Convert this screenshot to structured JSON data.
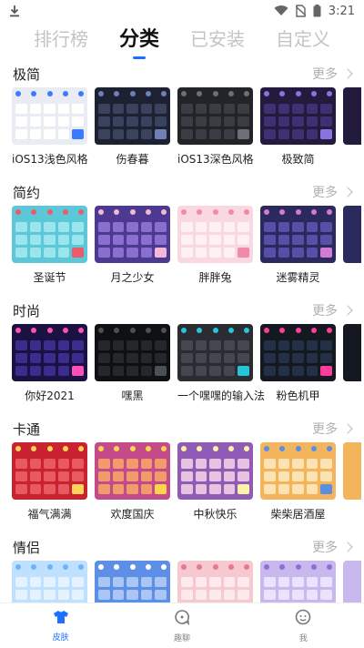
{
  "status_bar": {
    "time": "3:21"
  },
  "top_tabs": [
    {
      "label": "排行榜",
      "active": false
    },
    {
      "label": "分类",
      "active": true
    },
    {
      "label": "已安装",
      "active": false
    },
    {
      "label": "自定义",
      "active": false
    }
  ],
  "more_label": "更多",
  "sections": [
    {
      "title": "极简",
      "items": [
        {
          "name": "iOS13浅色风格",
          "theme": "light"
        },
        {
          "name": "伤春暮",
          "theme": "navy"
        },
        {
          "name": "iOS13深色风格",
          "theme": "dark"
        },
        {
          "name": "极致简",
          "theme": "purple"
        }
      ]
    },
    {
      "title": "简约",
      "items": [
        {
          "name": "圣诞节",
          "theme": "teal"
        },
        {
          "name": "月之少女",
          "theme": "violet"
        },
        {
          "name": "胖胖兔",
          "theme": "pink"
        },
        {
          "name": "迷雾精灵",
          "theme": "mist"
        }
      ]
    },
    {
      "title": "时尚",
      "items": [
        {
          "name": "你好2021",
          "theme": "neon"
        },
        {
          "name": "嘿黑",
          "theme": "black"
        },
        {
          "name": "一个嘿嘿的输入法",
          "theme": "charcoal"
        },
        {
          "name": "粉色机甲",
          "theme": "mecha"
        }
      ]
    },
    {
      "title": "卡通",
      "items": [
        {
          "name": "福气满满",
          "theme": "red"
        },
        {
          "name": "欢度国庆",
          "theme": "orange"
        },
        {
          "name": "中秋快乐",
          "theme": "autumn"
        },
        {
          "name": "柴柴居酒屋",
          "theme": "shiba"
        }
      ]
    },
    {
      "title": "情侣",
      "items": [
        {
          "name": "",
          "theme": "sky"
        },
        {
          "name": "",
          "theme": "blue"
        },
        {
          "name": "",
          "theme": "rose"
        },
        {
          "name": "",
          "theme": "lilac"
        }
      ]
    }
  ],
  "bottom_nav": [
    {
      "label": "皮肤",
      "icon": "shirt-icon",
      "active": true
    },
    {
      "label": "趣聊",
      "icon": "chat-icon",
      "active": false
    },
    {
      "label": "我",
      "icon": "profile-icon",
      "active": false
    }
  ],
  "colors": {
    "accent": "#1e6fff",
    "inactive_tab": "#c4c4c4",
    "more": "#b0b0b0"
  }
}
